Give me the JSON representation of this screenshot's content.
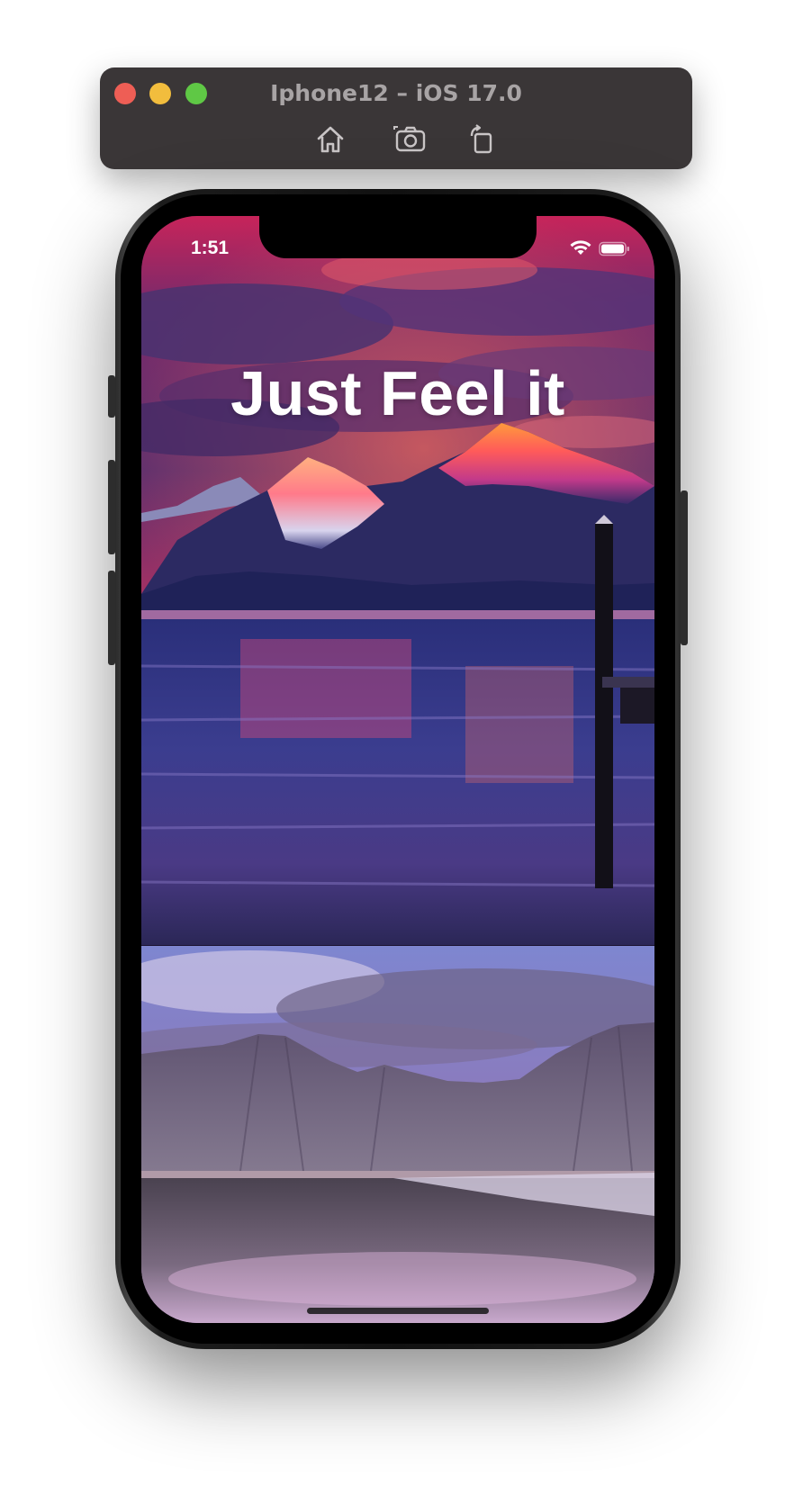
{
  "simulator": {
    "title": "Iphone12 – iOS 17.0",
    "toolbar": [
      "home-icon",
      "screenshot-icon",
      "rotate-icon"
    ],
    "traffic_lights": {
      "close": "#ee5e55",
      "minimize": "#f2bd3d",
      "zoom": "#5fc845"
    }
  },
  "status_bar": {
    "time": "1:51",
    "icons": [
      "wifi-icon",
      "battery-icon"
    ]
  },
  "app": {
    "headline": "Just Feel it",
    "images": [
      "sunset-mountain-lake-image",
      "misty-mountain-beach-image"
    ]
  }
}
